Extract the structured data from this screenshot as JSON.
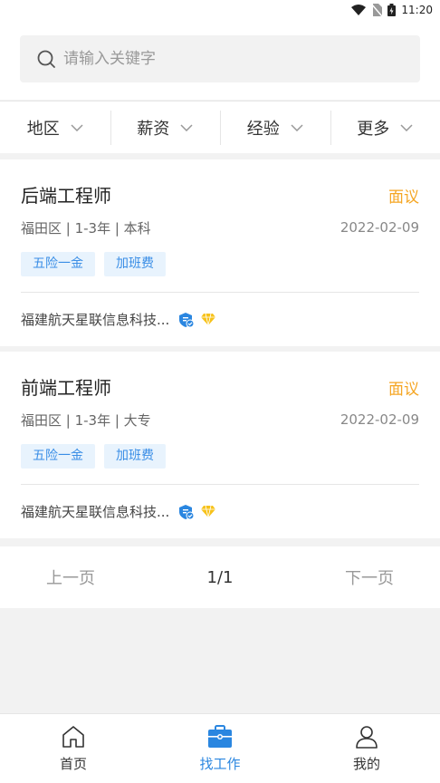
{
  "status_bar": {
    "time": "11:20"
  },
  "search": {
    "placeholder": "请输入关键字",
    "value": ""
  },
  "filters": [
    {
      "label": "地区"
    },
    {
      "label": "薪资"
    },
    {
      "label": "经验"
    },
    {
      "label": "更多"
    }
  ],
  "jobs": [
    {
      "title": "后端工程师",
      "salary": "面议",
      "meta": "福田区 | 1-3年 | 本科",
      "date": "2022-02-09",
      "tags": [
        "五险一金",
        "加班费"
      ],
      "company": "福建航天星联信息科技..."
    },
    {
      "title": "前端工程师",
      "salary": "面议",
      "meta": "福田区 | 1-3年 | 大专",
      "date": "2022-02-09",
      "tags": [
        "五险一金",
        "加班费"
      ],
      "company": "福建航天星联信息科技..."
    }
  ],
  "pagination": {
    "prev": "上一页",
    "page": "1/1",
    "next": "下一页"
  },
  "tabbar": [
    {
      "label": "首页",
      "icon": "home-icon"
    },
    {
      "label": "找工作",
      "icon": "briefcase-icon",
      "active": true
    },
    {
      "label": "我的",
      "icon": "user-icon"
    }
  ],
  "colors": {
    "accent": "#2a86e0",
    "salary": "#f5a623",
    "tag_bg": "#e8f3fd",
    "tag_text": "#3a8ee6"
  }
}
